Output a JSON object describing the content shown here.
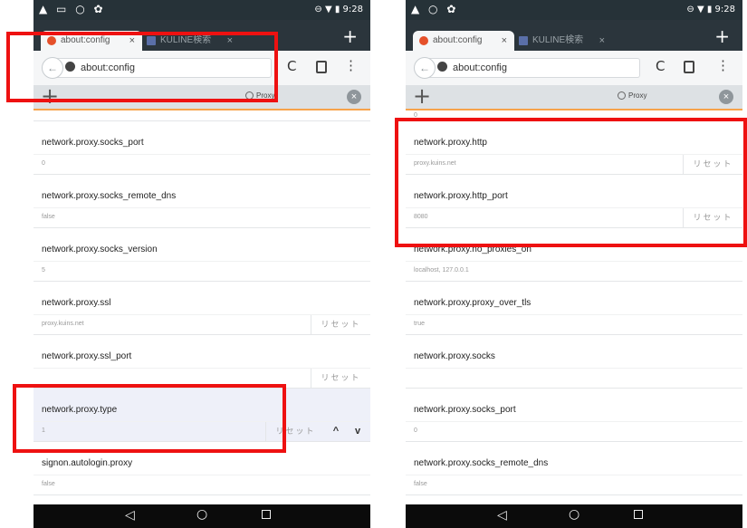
{
  "colors": {
    "highlight": "#ee1111",
    "accent": "#f7a34b",
    "status_bar": "#263238"
  },
  "left": {
    "status": {
      "left_icons": "▲ ▭ ○ ✿",
      "right": "⊖ ▼ ▮ 9:28"
    },
    "tabs": [
      {
        "label": "about:config",
        "close": "×"
      },
      {
        "label": "KULINE検索",
        "close": "×"
      }
    ],
    "new_tab": "+",
    "url": "about:config",
    "back": "←",
    "reload": "C",
    "menu": "⋮",
    "add": "+",
    "search": "Proxy",
    "clear": "×",
    "rows": [
      {
        "name": "network.proxy.socks_port",
        "value": "0",
        "reset": ""
      },
      {
        "name": "network.proxy.socks_remote_dns",
        "value": "false",
        "reset": ""
      },
      {
        "name": "network.proxy.socks_version",
        "value": "5",
        "reset": ""
      },
      {
        "name": "network.proxy.ssl",
        "value": "proxy.kuins.net",
        "reset": "リセット"
      },
      {
        "name": "network.proxy.ssl_port",
        "value": "",
        "reset": "リセット"
      },
      {
        "name": "network.proxy.type",
        "value": "1",
        "reset": "リセット"
      },
      {
        "name": "signon.autologin.proxy",
        "value": "false",
        "reset": ""
      }
    ],
    "up": "^",
    "down": "v",
    "nav": {
      "back": "◁",
      "home": "○"
    }
  },
  "right": {
    "status": {
      "left_icons": "▲ ○ ✿",
      "right": "⊖ ▼ ▮ 9:28"
    },
    "tabs": [
      {
        "label": "about:config",
        "close": "×"
      },
      {
        "label": "KULINE検索",
        "close": "×"
      }
    ],
    "new_tab": "+",
    "url": "about:config",
    "back": "←",
    "reload": "C",
    "menu": "⋮",
    "add": "+",
    "search": "Proxy",
    "clear": "×",
    "top_value": "0",
    "rows": [
      {
        "name": "network.proxy.http",
        "value": "proxy.kuins.net",
        "reset": "リセット"
      },
      {
        "name": "network.proxy.http_port",
        "value": "8080",
        "reset": "リセット"
      },
      {
        "name": "network.proxy.no_proxies_on",
        "value": "localhost, 127.0.0.1",
        "reset": ""
      },
      {
        "name": "network.proxy.proxy_over_tls",
        "value": "true",
        "reset": ""
      },
      {
        "name": "network.proxy.socks",
        "value": "",
        "reset": ""
      },
      {
        "name": "network.proxy.socks_port",
        "value": "0",
        "reset": ""
      },
      {
        "name": "network.proxy.socks_remote_dns",
        "value": "false",
        "reset": ""
      }
    ],
    "nav": {
      "back": "◁",
      "home": "○"
    }
  }
}
